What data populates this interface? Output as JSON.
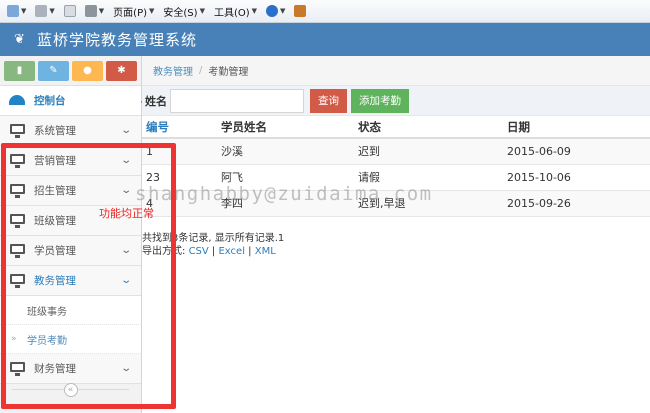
{
  "toolbar": {
    "page_menu": "页面(P)",
    "security_menu": "安全(S)",
    "tools_menu": "工具(O)"
  },
  "header": {
    "title": "蓝桥学院教务管理系统"
  },
  "sidebar": {
    "items": [
      {
        "label": "控制台"
      },
      {
        "label": "系统管理"
      },
      {
        "label": "营销管理"
      },
      {
        "label": "招生管理"
      },
      {
        "label": "班级管理"
      },
      {
        "label": "学员管理"
      },
      {
        "label": "教务管理"
      },
      {
        "label": "班级事务"
      },
      {
        "label": "学员考勤"
      },
      {
        "label": "财务管理"
      }
    ],
    "collapse_icon": "«"
  },
  "breadcrumb": {
    "parent": "教务管理",
    "current": "考勤管理"
  },
  "search": {
    "label": "姓名",
    "value": "",
    "query_button": "查询",
    "add_button": "添加考勤"
  },
  "table": {
    "headers": [
      "编号",
      "学员姓名",
      "状态",
      "日期"
    ],
    "rows": [
      [
        "1",
        "沙溪",
        "迟到",
        "2015-06-09"
      ],
      [
        "23",
        "阿飞",
        "请假",
        "2015-10-06"
      ],
      [
        "4",
        "李四",
        "迟到,早退",
        "2015-09-26"
      ]
    ]
  },
  "summary": {
    "text": "共找到3条记录, 显示所有记录.1",
    "export_label": "导出方式:",
    "csv": "CSV",
    "excel": "Excel",
    "xml": "XML",
    "sep": "|"
  },
  "overlay": {
    "watermark": "shanghabby@zuidaima.com",
    "annotation": "功能均正常",
    "highlight_color": "#ee3333"
  },
  "colors": {
    "header": "#4781b8",
    "accent": "#2b7dbc",
    "danger": "#d15b47",
    "success": "#5fb35c"
  }
}
